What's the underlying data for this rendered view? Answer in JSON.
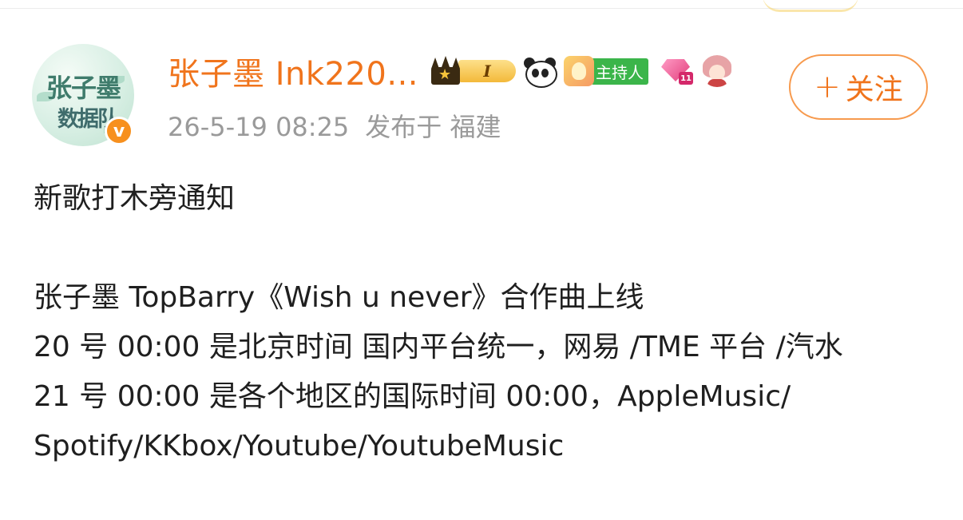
{
  "post": {
    "author": {
      "name": "张子墨 Ink220...",
      "avatar_text_top": "张子墨",
      "avatar_text_bottom": "数据队",
      "verified_mark": "v",
      "level_label": "I",
      "host_badge_label": "主持人",
      "gem_level": "11"
    },
    "timestamp": "26-5-19 08:25",
    "location": "发布于 福建",
    "follow_label": "关注",
    "follow_plus": "+",
    "body": {
      "title": "新歌打木旁通知",
      "line1": "张子墨 TopBarry《Wish u never》合作曲上线",
      "line2": "20 号 00:00 是北京时间 国内平台统一，网易 /TME 平台 /汽水",
      "line3": "21 号 00:00 是各个地区的国际时间 00:00，AppleMusic/ Spotify/KKbox/Youtube/YoutubeMusic"
    }
  },
  "icons": {
    "verified": "verified-v-icon",
    "crown": "crown-icon",
    "panda": "panda-icon",
    "host": "host-avatar-icon",
    "gem": "diamond-gem-icon",
    "girl": "anime-girl-icon"
  },
  "colors": {
    "username": "#f0741c",
    "follow_border": "#f79a4e",
    "verified": "#f7901e",
    "host_badge": "#3bb54a",
    "meta_text": "#9a9a9a"
  }
}
